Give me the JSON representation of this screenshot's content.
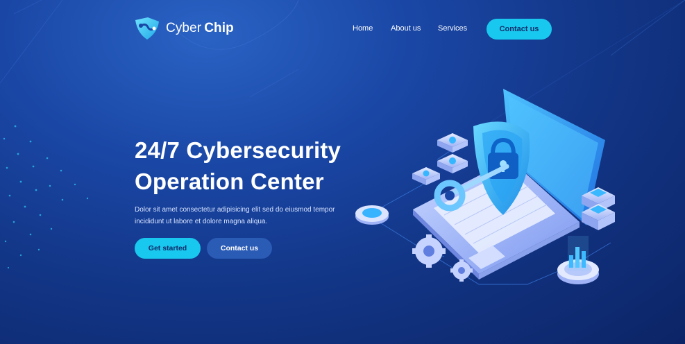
{
  "brand": {
    "name_part1": "Cyber",
    "name_part2": "Chip"
  },
  "nav": {
    "items": [
      {
        "label": "Home"
      },
      {
        "label": "About us"
      },
      {
        "label": "Services"
      }
    ],
    "cta_label": "Contact us"
  },
  "hero": {
    "title_line1": "24/7 Cybersecurity",
    "title_line2": "Operation Center",
    "description_line1": "Dolor sit amet consectetur adipisicing elit sed do eiusmod tempor",
    "description_line2": "incididunt ut labore et dolore magna aliqua.",
    "primary_button": "Get started",
    "secondary_button": "Contact us"
  },
  "colors": {
    "accent": "#19c8ee",
    "background": "#123585",
    "secondary_button": "#2a5bb5"
  },
  "icons": {
    "logo": "shield-chip-icon",
    "illustration": "laptop-shield-lock-key-illustration"
  }
}
